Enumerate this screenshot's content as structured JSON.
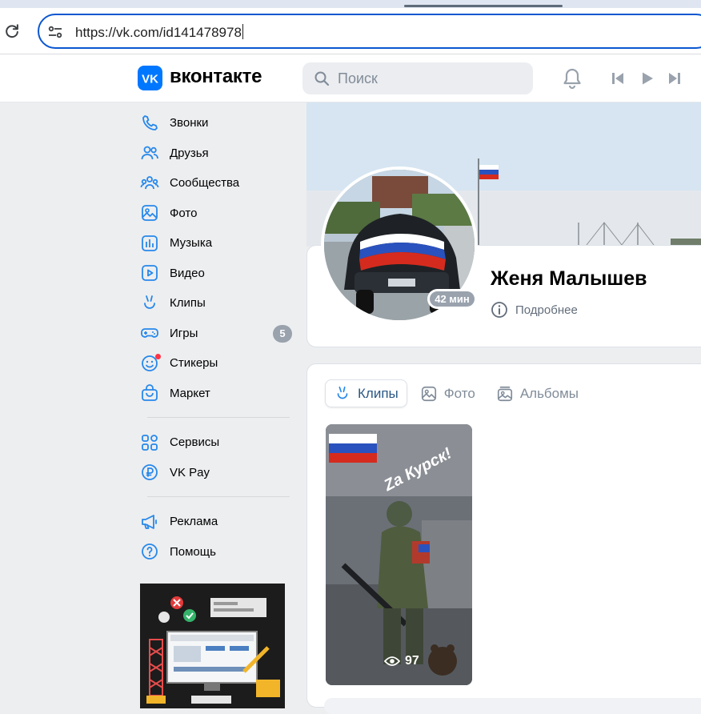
{
  "browser": {
    "url": "https://vk.com/id141478978"
  },
  "header": {
    "brand": "вконтакте",
    "search_placeholder": "Поиск"
  },
  "sidebar": {
    "items": [
      {
        "label": "Звонки",
        "icon": "phone-icon"
      },
      {
        "label": "Друзья",
        "icon": "friends-icon"
      },
      {
        "label": "Сообщества",
        "icon": "communities-icon"
      },
      {
        "label": "Фото",
        "icon": "photo-icon"
      },
      {
        "label": "Музыка",
        "icon": "music-icon"
      },
      {
        "label": "Видео",
        "icon": "video-icon"
      },
      {
        "label": "Клипы",
        "icon": "clips-icon"
      },
      {
        "label": "Игры",
        "icon": "games-icon",
        "badge": "5"
      },
      {
        "label": "Стикеры",
        "icon": "stickers-icon"
      },
      {
        "label": "Маркет",
        "icon": "market-icon"
      }
    ],
    "services": [
      {
        "label": "Сервисы",
        "icon": "services-icon"
      },
      {
        "label": "VK Pay",
        "icon": "vkpay-icon"
      }
    ],
    "footer": [
      {
        "label": "Реклама",
        "icon": "ads-icon"
      },
      {
        "label": "Помощь",
        "icon": "help-icon"
      }
    ]
  },
  "profile": {
    "name": "Женя Малышев",
    "online": "42 мин",
    "more": "Подробнее"
  },
  "media": {
    "tabs": [
      {
        "label": "Клипы",
        "active": true
      },
      {
        "label": "Фото",
        "active": false
      },
      {
        "label": "Альбомы",
        "active": false
      }
    ],
    "clip": {
      "caption": "Za Курск!",
      "views": "97"
    }
  },
  "colors": {
    "vk_blue": "#0077ff",
    "link": "#2a5885",
    "badge": "#99a2ad",
    "page_bg": "#edeef0"
  }
}
